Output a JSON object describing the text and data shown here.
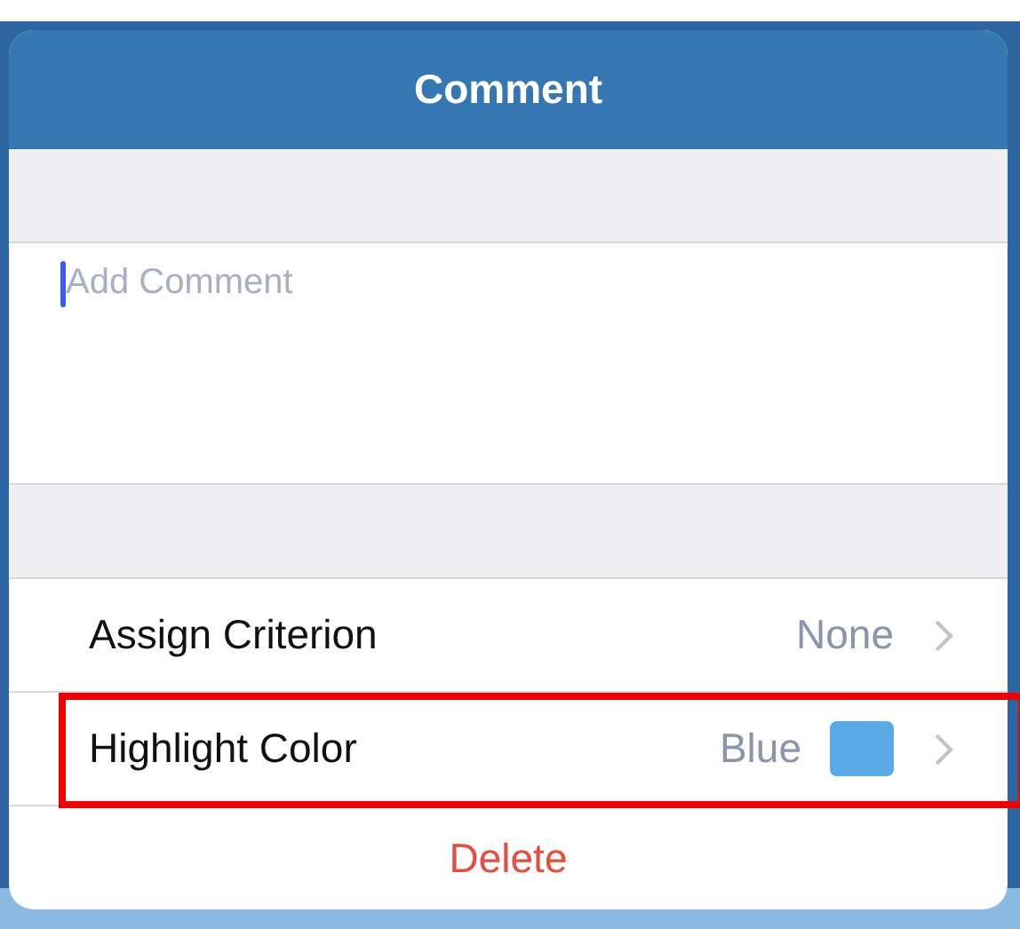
{
  "popover": {
    "title": "Comment"
  },
  "comment_field": {
    "placeholder": "Add Comment",
    "focused": true
  },
  "rows": [
    {
      "kind": "detail",
      "label": "Assign Criterion",
      "value": "None",
      "highlighted": false
    },
    {
      "kind": "swatch",
      "label": "Highlight Color",
      "value": "Blue",
      "color": "#5aaae8",
      "highlighted": true
    }
  ],
  "delete_button": {
    "label": "Delete"
  }
}
